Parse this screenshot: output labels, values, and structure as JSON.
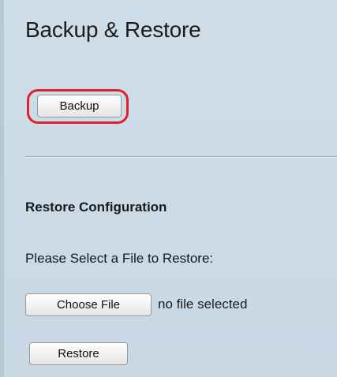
{
  "page": {
    "title": "Backup & Restore"
  },
  "backup": {
    "button_label": "Backup",
    "highlight_color": "#e2202a"
  },
  "restore_section": {
    "heading": "Restore Configuration",
    "prompt": "Please Select a File to Restore:",
    "choose_file_label": "Choose File",
    "file_status": "no file selected",
    "restore_label": "Restore"
  },
  "colors": {
    "background": "#c9d9e6",
    "text": "#1a1a1a"
  }
}
